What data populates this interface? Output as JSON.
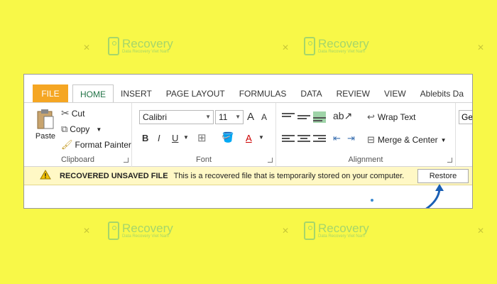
{
  "watermark": {
    "brand": "Recovery",
    "sub": "Data Recovery Viet Nam"
  },
  "tabs": [
    {
      "label": "FILE"
    },
    {
      "label": "HOME"
    },
    {
      "label": "INSERT"
    },
    {
      "label": "PAGE LAYOUT"
    },
    {
      "label": "FORMULAS"
    },
    {
      "label": "DATA"
    },
    {
      "label": "REVIEW"
    },
    {
      "label": "VIEW"
    },
    {
      "label": "Ablebits Da"
    }
  ],
  "clipboard": {
    "label": "Clipboard",
    "paste": "Paste",
    "cut": "Cut",
    "copy": "Copy",
    "format_painter": "Format Painter"
  },
  "font": {
    "label": "Font",
    "family": "Calibri",
    "size": "11",
    "grow": "A",
    "shrink": "A",
    "bold": "B",
    "italic": "I",
    "underline": "U",
    "color": "A"
  },
  "alignment": {
    "label": "Alignment",
    "wrap_text": "Wrap Text",
    "merge_center": "Merge & Center"
  },
  "number": {
    "format": "Ge"
  },
  "message_bar": {
    "title": "RECOVERED UNSAVED FILE",
    "text": "This is a recovered file that is temporarily stored on your computer.",
    "restore": "Restore"
  },
  "colors": {
    "background": "#f8f848",
    "file_tab": "#f5a623",
    "home_tab_text": "#217346",
    "message_bar": "#fff8c5",
    "arrow": "#1a5fb4"
  }
}
